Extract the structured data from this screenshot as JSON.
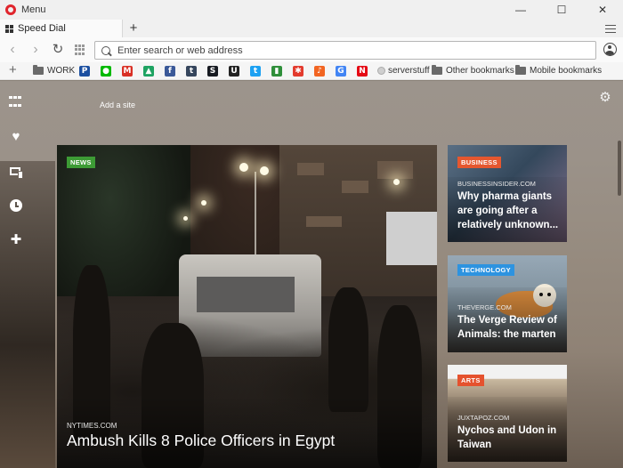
{
  "window": {
    "menu_label": "Menu",
    "controls": {
      "minimize": "—",
      "maximize": "☐",
      "close": "✕"
    }
  },
  "tabs": [
    {
      "title": "Speed Dial",
      "active": true
    }
  ],
  "new_tab_label": "+",
  "addressbar": {
    "placeholder": "Enter search or web address",
    "value": ""
  },
  "bookmarks": {
    "add_label": "+",
    "items": [
      {
        "type": "folder",
        "label": "WORK"
      },
      {
        "type": "icon",
        "name": "paypal-icon",
        "glyph": "P",
        "color": "#1b4fa0"
      },
      {
        "type": "icon",
        "name": "line-icon",
        "glyph": "●",
        "color": "#00b900"
      },
      {
        "type": "icon",
        "name": "gmail-icon",
        "glyph": "M",
        "color": "#d93025"
      },
      {
        "type": "icon",
        "name": "drive-icon",
        "glyph": "▲",
        "color": "#1ea362"
      },
      {
        "type": "icon",
        "name": "facebook-icon",
        "glyph": "f",
        "color": "#3b5998"
      },
      {
        "type": "icon",
        "name": "tumblr-icon",
        "glyph": "t",
        "color": "#36465d"
      },
      {
        "type": "icon",
        "name": "steam-icon",
        "glyph": "S",
        "color": "#171a21"
      },
      {
        "type": "icon",
        "name": "ubc-icon",
        "glyph": "U",
        "color": "#222222"
      },
      {
        "type": "icon",
        "name": "twitter-icon",
        "glyph": "t",
        "color": "#1da1f2"
      },
      {
        "type": "icon",
        "name": "chart-bookmark-icon",
        "glyph": "▮",
        "color": "#2f8f3a"
      },
      {
        "type": "icon",
        "name": "app-bookmark-icon",
        "glyph": "✱",
        "color": "#e33b2e"
      },
      {
        "type": "icon",
        "name": "music-icon",
        "glyph": "♪",
        "color": "#f26522"
      },
      {
        "type": "icon",
        "name": "google-icon",
        "glyph": "G",
        "color": "#4285f4"
      },
      {
        "type": "icon",
        "name": "netflix-icon",
        "glyph": "N",
        "color": "#e50914"
      }
    ],
    "serverstuff_label": "serverstuff",
    "other_label": "Other bookmarks",
    "mobile_label": "Mobile bookmarks"
  },
  "speed_dial": {
    "add_site_label": "Add a site"
  },
  "news": {
    "main": {
      "category": "NEWS",
      "source": "NYTIMES.COM",
      "headline": "Ambush Kills 8 Police Officers in Egypt"
    },
    "side": [
      {
        "category": "BUSINESS",
        "source": "BUSINESSINSIDER.COM",
        "headline": "Why pharma giants are going after a relatively unknown...",
        "color": "#e5572f"
      },
      {
        "category": "TECHNOLOGY",
        "source": "THEVERGE.COM",
        "headline": "The Verge Review of Animals: the marten",
        "color": "#2d93e0"
      },
      {
        "category": "ARTS",
        "source": "JUXTAPOZ.COM",
        "headline": "Nychos and Udon in Taiwan",
        "color": "#e5522e"
      }
    ]
  }
}
